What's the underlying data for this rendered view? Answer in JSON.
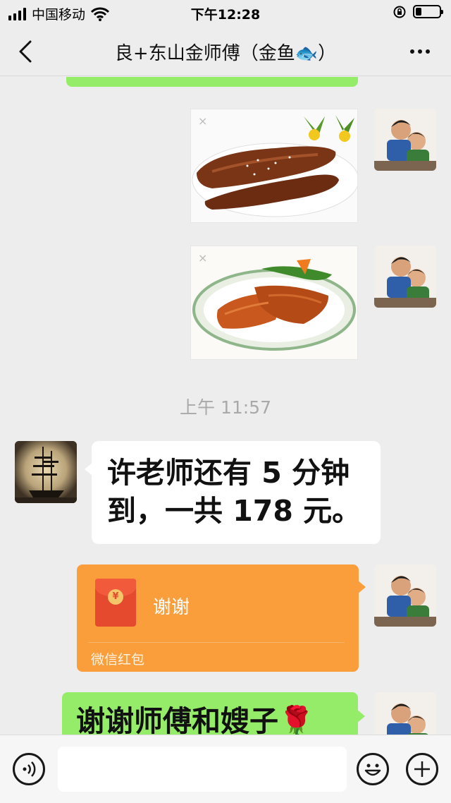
{
  "status_bar": {
    "carrier": "中国移动",
    "time": "下午12:28",
    "battery_level": 0.25
  },
  "nav": {
    "title": "良+东山金师傅（金鱼🐟）",
    "icons": [
      "chevron-left-icon",
      "more-icon"
    ]
  },
  "chat": {
    "timestamp": "上午 11:57",
    "incoming_text": "许老师还有 5 分钟到，一共 178 元。",
    "incoming_line1": "许老师还有 5 分钟",
    "incoming_line2": "到，一共 178 元。",
    "red_packet": {
      "message": "谢谢",
      "footer": "微信红包",
      "color": "#fa9d3b"
    },
    "outgoing_text": "谢谢师傅和嫂子🌹",
    "images": [
      "fried-fish-photo",
      "fried-fish-platter-photo"
    ]
  },
  "input_bar": {
    "icons": [
      "voice-icon",
      "emoji-icon",
      "plus-icon"
    ]
  },
  "colors": {
    "background": "#ededed",
    "green_bubble": "#95ec69",
    "red_packet": "#fa9d3b"
  }
}
